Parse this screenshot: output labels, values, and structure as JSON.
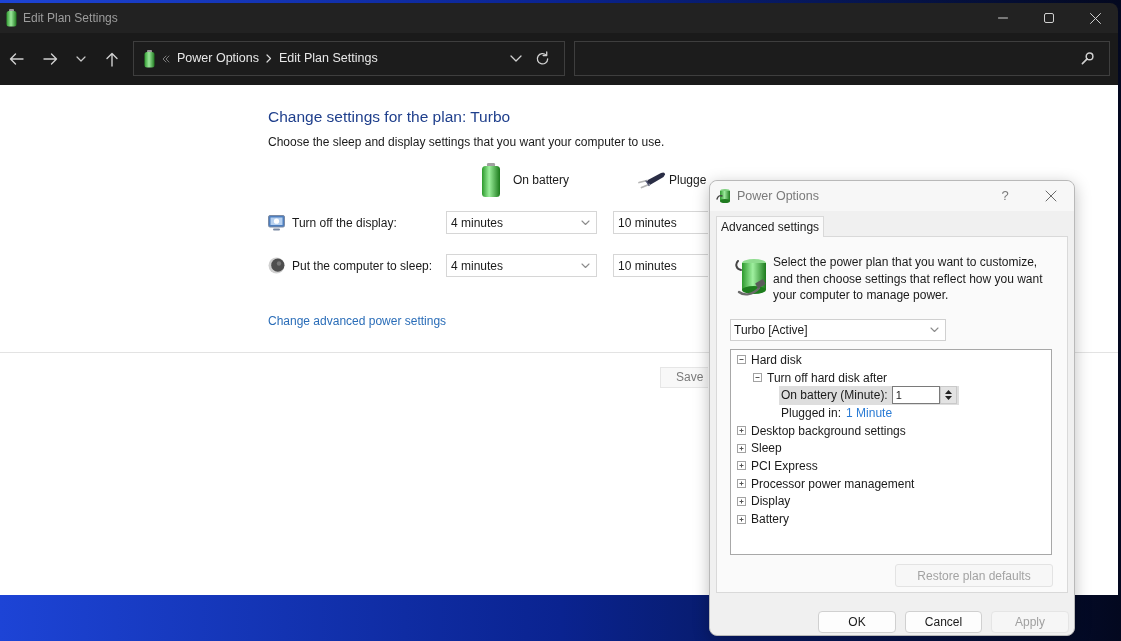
{
  "window": {
    "title": "Edit Plan Settings"
  },
  "address_bar": {
    "crumbs": [
      "Power Options",
      "Edit Plan Settings"
    ]
  },
  "content": {
    "heading": "Change settings for the plan: Turbo",
    "intro": "Choose the sleep and display settings that you want your computer to use.",
    "columns": [
      {
        "kind": "battery",
        "label": "On battery"
      },
      {
        "kind": "plug",
        "label": "Plugge"
      }
    ],
    "settings": [
      {
        "kind": "display",
        "label": "Turn off the display:",
        "values": [
          "4 minutes",
          "10 minutes"
        ]
      },
      {
        "kind": "sleep",
        "label": "Put the computer to sleep:",
        "values": [
          "4 minutes",
          "10 minutes"
        ]
      }
    ],
    "advanced_link": "Change advanced power settings",
    "save_button": {
      "label": "Save",
      "disabled": true
    }
  },
  "dialog": {
    "title": "Power Options",
    "help": "?",
    "tabs": [
      {
        "label": "Advanced settings",
        "selected": true
      }
    ],
    "description": "Select the power plan that you want to customize, and then choose settings that reflect how you want your computer to manage power.",
    "plan": "Turbo [Active]",
    "tree": [
      {
        "kind": "group",
        "label": "Hard disk",
        "expanded": true,
        "selected": false,
        "children": [
          {
            "kind": "group",
            "label": "Turn off hard disk after",
            "expanded": true,
            "selected": false,
            "children": [
              {
                "kind": "spin",
                "label": "On battery (Minute):",
                "value": "1",
                "selected": true
              },
              {
                "kind": "link",
                "label": "Plugged in:",
                "value": "1 Minute",
                "selected": false
              }
            ]
          }
        ]
      },
      {
        "kind": "group",
        "label": "Desktop background settings",
        "expanded": false,
        "selected": false
      },
      {
        "kind": "group",
        "label": "Sleep",
        "expanded": false,
        "selected": false
      },
      {
        "kind": "group",
        "label": "PCI Express",
        "expanded": false,
        "selected": false
      },
      {
        "kind": "group",
        "label": "Processor power management",
        "expanded": false,
        "selected": false
      },
      {
        "kind": "group",
        "label": "Display",
        "expanded": false,
        "selected": false
      },
      {
        "kind": "group",
        "label": "Battery",
        "expanded": false,
        "selected": false
      }
    ],
    "restore_button": {
      "label": "Restore plan defaults",
      "disabled": true
    },
    "buttons": [
      {
        "label": "OK",
        "disabled": false
      },
      {
        "label": "Cancel",
        "disabled": false
      },
      {
        "label": "Apply",
        "disabled": true
      }
    ]
  }
}
